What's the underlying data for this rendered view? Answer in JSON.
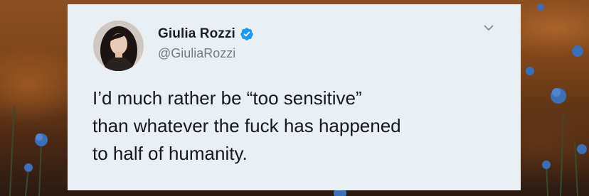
{
  "tweet": {
    "author": {
      "display_name": "Giulia Rozzi",
      "handle": "@GiuliaRozzi",
      "verified": true,
      "avatar_icon": "profile-photo"
    },
    "menu_icon": "chevron-down-icon",
    "text_lines": [
      "I’d much rather be “too sensitive”",
      "than whatever the fuck has happened",
      "to half of humanity."
    ]
  },
  "colors": {
    "card_background": "#e9eff3",
    "verified_badge": "#1d9bf0",
    "handle_text": "#6e7c88",
    "body_text": "#15191d"
  }
}
